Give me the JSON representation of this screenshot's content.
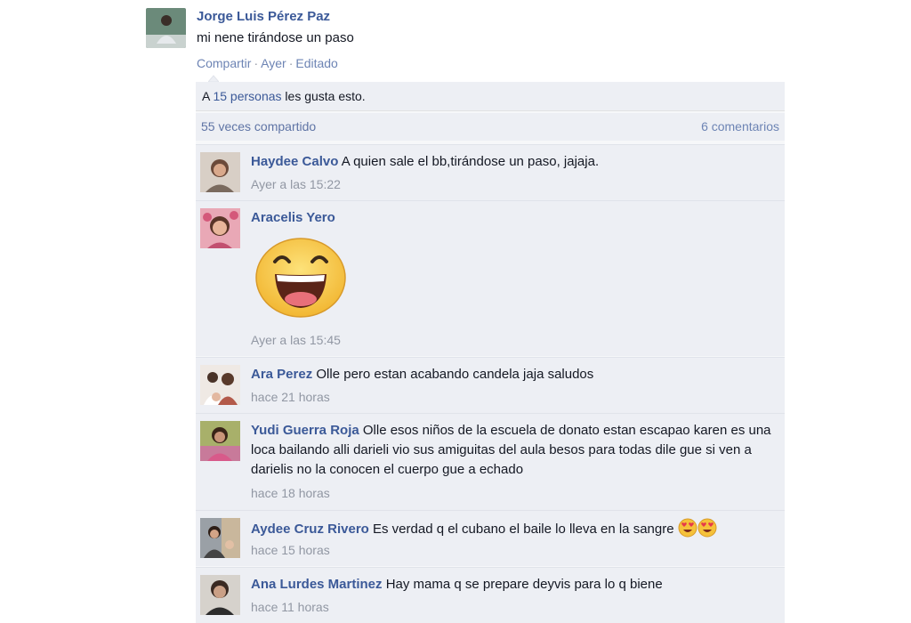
{
  "post": {
    "author": "Jorge Luis Pérez Paz",
    "text": "mi nene tirándose un paso",
    "actions": {
      "share": "Compartir",
      "time": "Ayer",
      "edited": "Editado",
      "separator": "·"
    }
  },
  "likes": {
    "prefix": "A ",
    "count_link": "15 personas",
    "suffix": " les gusta esto."
  },
  "shares": {
    "label": "55 veces compartido",
    "comments_count": "6 comentarios"
  },
  "comments": [
    {
      "author": "Haydee Calvo",
      "text": "A quien sale el bb,tirándose un paso, jajaja.",
      "time": "Ayer a las 15:22"
    },
    {
      "author": "Aracelis Yero",
      "text": "",
      "sticker": "laughing-face-sticker",
      "time": "Ayer a las 15:45"
    },
    {
      "author": "Ara Perez",
      "text": "Olle pero estan acabando candela jaja saludos",
      "time": "hace 21 horas"
    },
    {
      "author": "Yudi Guerra Roja",
      "text": "Olle esos niños de la escuela de donato estan escapao karen es una loca bailando alli darieli vio sus amiguitas del aula besos para todas dile gue si ven a darielis no la conocen el cuerpo gue a echado",
      "time": "hace 18 horas"
    },
    {
      "author": "Aydee Cruz Rivero",
      "text": "Es verdad q el cubano el baile lo lleva en la sangre",
      "emoji": "heart-eyes-emoji",
      "time": "hace 15 horas"
    },
    {
      "author": "Ana Lurdes Martinez",
      "text": "Hay mama q se prepare deyvis para lo q biene",
      "time": "hace 11 horas"
    }
  ],
  "colors": {
    "link": "#3b5998",
    "muted": "#9197a3",
    "panel": "#edeff4"
  }
}
